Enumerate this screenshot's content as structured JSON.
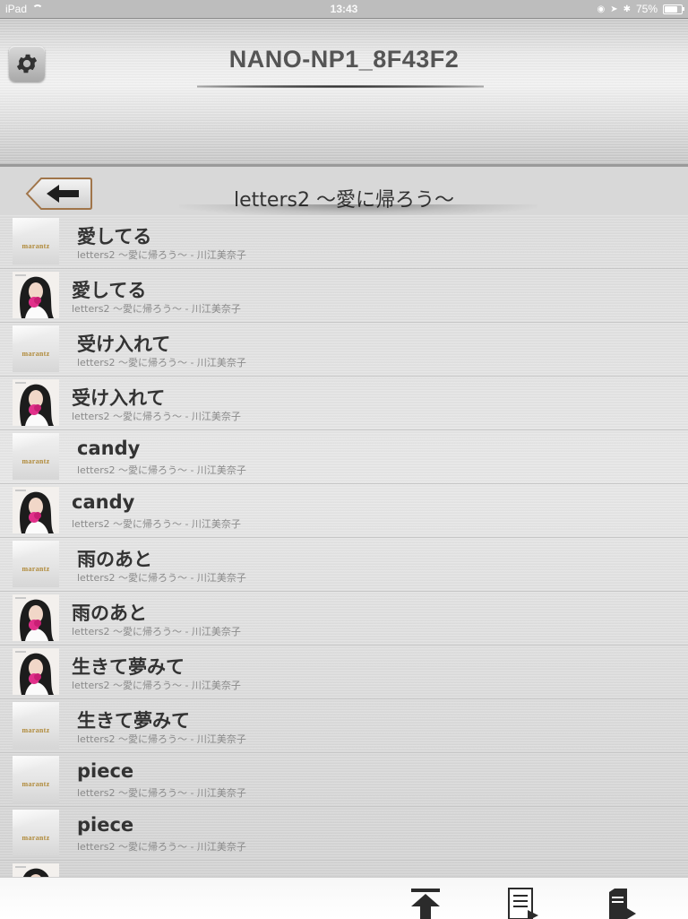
{
  "status_bar": {
    "device": "iPad",
    "time": "13:43",
    "battery": "75%",
    "battery_level": 0.75
  },
  "header": {
    "device_name": "NANO-NP1_8F43F2"
  },
  "album": {
    "title": "letters2 〜愛に帰ろう〜"
  },
  "tracks": [
    {
      "name": "愛してる",
      "subtitle": "letters2 〜愛に帰ろう〜 - 川江美奈子",
      "thumb": "logo",
      "logo_text": "marantz"
    },
    {
      "name": "愛してる",
      "subtitle": "letters2 〜愛に帰ろう〜 - 川江美奈子",
      "thumb": "art"
    },
    {
      "name": "受け入れて",
      "subtitle": "letters2 〜愛に帰ろう〜 - 川江美奈子",
      "thumb": "logo",
      "logo_text": "marantz"
    },
    {
      "name": "受け入れて",
      "subtitle": "letters2 〜愛に帰ろう〜 - 川江美奈子",
      "thumb": "art"
    },
    {
      "name": "candy",
      "subtitle": "letters2 〜愛に帰ろう〜 - 川江美奈子",
      "thumb": "logo",
      "logo_text": "marantz"
    },
    {
      "name": "candy",
      "subtitle": "letters2 〜愛に帰ろう〜 - 川江美奈子",
      "thumb": "art"
    },
    {
      "name": "雨のあと",
      "subtitle": "letters2 〜愛に帰ろう〜 - 川江美奈子",
      "thumb": "logo",
      "logo_text": "marantz"
    },
    {
      "name": "雨のあと",
      "subtitle": "letters2 〜愛に帰ろう〜 - 川江美奈子",
      "thumb": "art"
    },
    {
      "name": "生きて夢みて",
      "subtitle": "letters2 〜愛に帰ろう〜 - 川江美奈子",
      "thumb": "art"
    },
    {
      "name": "生きて夢みて",
      "subtitle": "letters2 〜愛に帰ろう〜 - 川江美奈子",
      "thumb": "logo",
      "logo_text": "marantz"
    },
    {
      "name": "piece",
      "subtitle": "letters2 〜愛に帰ろう〜 - 川江美奈子",
      "thumb": "logo",
      "logo_text": "marantz"
    },
    {
      "name": "piece",
      "subtitle": "letters2 〜愛に帰ろう〜 - 川江美奈子",
      "thumb": "logo",
      "logo_text": "marantz"
    },
    {
      "name": "",
      "subtitle": "",
      "thumb": "art"
    }
  ],
  "toolbar": {
    "icons": [
      "scroll-to-top-icon",
      "playlist-icon",
      "server-icon"
    ]
  },
  "colors": {
    "header_text": "#555555",
    "logo_gold": "#b08a3a",
    "subtitle_gray": "#8a8a8a"
  }
}
